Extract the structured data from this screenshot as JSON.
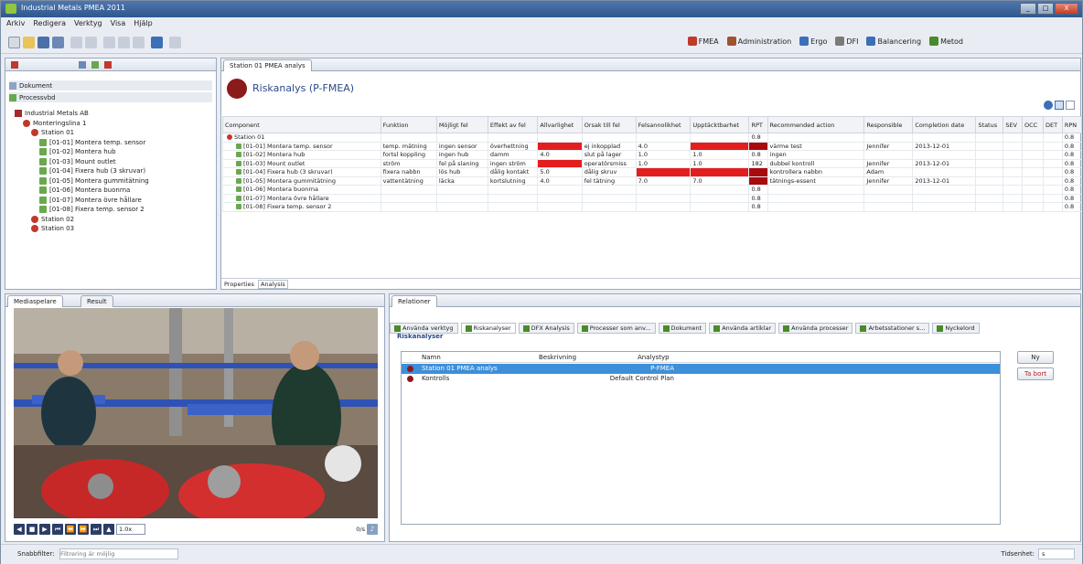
{
  "window": {
    "title": "Industrial Metals PMEA 2011",
    "controls": [
      "_",
      "□",
      "X"
    ]
  },
  "menu": [
    "Arkiv",
    "Redigera",
    "Verktyg",
    "Visa",
    "Hjälp"
  ],
  "perspectives": [
    {
      "label": "FMEA",
      "color": "#c0392b"
    },
    {
      "label": "Administration",
      "color": "#a0522d"
    },
    {
      "label": "Ergo",
      "color": "#3b6fb6"
    },
    {
      "label": "DFI",
      "color": "#7a7a7a"
    },
    {
      "label": "Balancering",
      "color": "#3b6fb6"
    },
    {
      "label": "Metod",
      "color": "#4a8a2a"
    }
  ],
  "left_panel": {
    "items": [
      {
        "label": "Dokument",
        "type": "header"
      },
      {
        "label": "Processvbd",
        "type": "header"
      },
      {
        "label": "Industrial Metals AB",
        "type": "bi",
        "indent": 0
      },
      {
        "label": "Monteringslina 1",
        "type": "ri",
        "indent": 1
      },
      {
        "label": "Station 01",
        "type": "ri",
        "indent": 2
      },
      {
        "label": "[01-01] Montera temp. sensor",
        "type": "gi",
        "indent": 3
      },
      {
        "label": "[01-02] Montera hub",
        "type": "gi",
        "indent": 3
      },
      {
        "label": "[01-03] Mount outlet",
        "type": "gi",
        "indent": 3
      },
      {
        "label": "[01-04] Fixera hub (3 skruvar)",
        "type": "gi",
        "indent": 3
      },
      {
        "label": "[01-05] Montera gummitätning",
        "type": "gi",
        "indent": 3
      },
      {
        "label": "[01-06] Montera buonrna",
        "type": "gi",
        "indent": 3
      },
      {
        "label": "[01-07] Montera övre hållare",
        "type": "gi",
        "indent": 3
      },
      {
        "label": "[01-08] Fixera temp. sensor 2",
        "type": "gi",
        "indent": 3
      },
      {
        "label": "Station 02",
        "type": "ri",
        "indent": 2
      },
      {
        "label": "Station 03",
        "type": "ri",
        "indent": 2
      }
    ]
  },
  "editor": {
    "tab": "Station 01 PMEA analys",
    "heading": "Riskanalys (P-FMEA)",
    "bottom_tabs": [
      "Properties",
      "Analysis"
    ],
    "columns": [
      "Component",
      "Funktion",
      "Möjligt fel",
      "Effekt av fel",
      "Allvarlighet",
      "Orsak till fel",
      "Felsannolikhet",
      "Upptäcktbarhet",
      "RPT",
      "Recommended action",
      "Responsible",
      "Completion date",
      "Status",
      "SEV",
      "OCC",
      "DET",
      "RPN"
    ],
    "rows": [
      {
        "cells": [
          "Station 01",
          "",
          "",
          "",
          "",
          "",
          "",
          "",
          "0.8",
          "",
          "",
          "",
          "",
          "",
          "",
          "",
          "0.8"
        ],
        "level": 0,
        "hl": []
      },
      {
        "cells": [
          "[01-01] Montera temp. sensor",
          "temp. mätning",
          "ingen sensor",
          "överhettning",
          "",
          "ej inkopplad",
          "4.0",
          "",
          "",
          "värme test",
          "Jennifer",
          "2013-12-01",
          "",
          "",
          "",
          "",
          "0.8"
        ],
        "level": 1,
        "hl": [
          4,
          7,
          8
        ]
      },
      {
        "cells": [
          "[01-02] Montera hub",
          "fortsl koppling",
          "ingen hub",
          "damm",
          "4.0",
          "slut på lager",
          "1.0",
          "1.0",
          "0.8",
          "ingen",
          "",
          "",
          "",
          "",
          "",
          "",
          "0.8"
        ],
        "level": 1,
        "hl": []
      },
      {
        "cells": [
          "[01-03] Mount outlet",
          "ström",
          "fel på slaning",
          "ingen ström",
          "",
          "operatörsmiss",
          "1.0",
          "1.0",
          "182",
          "dubbel kontroll",
          "Jennifer",
          "2013-12-01",
          "",
          "",
          "",
          "",
          "0.8"
        ],
        "level": 1,
        "hl": [
          4
        ]
      },
      {
        "cells": [
          "[01-04] Fixera hub (3 skruvar)",
          "fixera nabbn",
          "lös hub",
          "dålig kontakt",
          "5.0",
          "dålig skruv",
          "",
          "",
          "",
          "kontrollera nabbn",
          "Adam",
          "",
          "",
          "",
          "",
          "",
          "0.8"
        ],
        "level": 1,
        "hl": [
          6,
          7,
          8
        ]
      },
      {
        "cells": [
          "[01-05] Montera gummitätning",
          "vattentätning",
          "läcka",
          "kortslutning",
          "4.0",
          "fel tätning",
          "7.0",
          "7.0",
          "",
          "tätnings-essent",
          "Jennifer",
          "2013-12-01",
          "",
          "",
          "",
          "",
          "0.8"
        ],
        "level": 1,
        "hl": [
          8
        ]
      },
      {
        "cells": [
          "[01-06] Montera buonrna",
          "",
          "",
          "",
          "",
          "",
          "",
          "",
          "0.8",
          "",
          "",
          "",
          "",
          "",
          "",
          "",
          "0.8"
        ],
        "level": 1,
        "hl": []
      },
      {
        "cells": [
          "[01-07] Montera övre hållare",
          "",
          "",
          "",
          "",
          "",
          "",
          "",
          "0.8",
          "",
          "",
          "",
          "",
          "",
          "",
          "",
          "0.8"
        ],
        "level": 1,
        "hl": []
      },
      {
        "cells": [
          "[01-08] Fixera temp. sensor 2",
          "",
          "",
          "",
          "",
          "",
          "",
          "",
          "0.8",
          "",
          "",
          "",
          "",
          "",
          "",
          "",
          "0.8"
        ],
        "level": 1,
        "hl": []
      }
    ]
  },
  "media": {
    "tabs": [
      "Mediaspelare",
      "Result"
    ],
    "speed": "1.0x",
    "counter": "0/s"
  },
  "relations": {
    "tab": "Relationer",
    "subtabs": [
      "Använda verktyg",
      "Riskanalyser",
      "DFX Analysis",
      "Processer som anv...",
      "Dokument",
      "Använda artiklar",
      "Använda processer",
      "Arbetsstationer s...",
      "Nyckelord"
    ],
    "section": "Riskanalyser",
    "columns": [
      "Namn",
      "Beskrivning",
      "Analystyp"
    ],
    "rows": [
      {
        "name": "Station 01 PMEA analys",
        "desc": "",
        "type": "P-FMEA",
        "selected": true
      },
      {
        "name": "Kontrolls",
        "desc": "",
        "type": "Default Control Plan",
        "selected": false
      }
    ],
    "buttons": [
      "Ny",
      "Ta bort"
    ]
  },
  "status": {
    "search_label": "Snabbfilter:",
    "search_placeholder": "Filtrering är möjlig",
    "right": "Tidsenhet:",
    "unit": "s"
  }
}
